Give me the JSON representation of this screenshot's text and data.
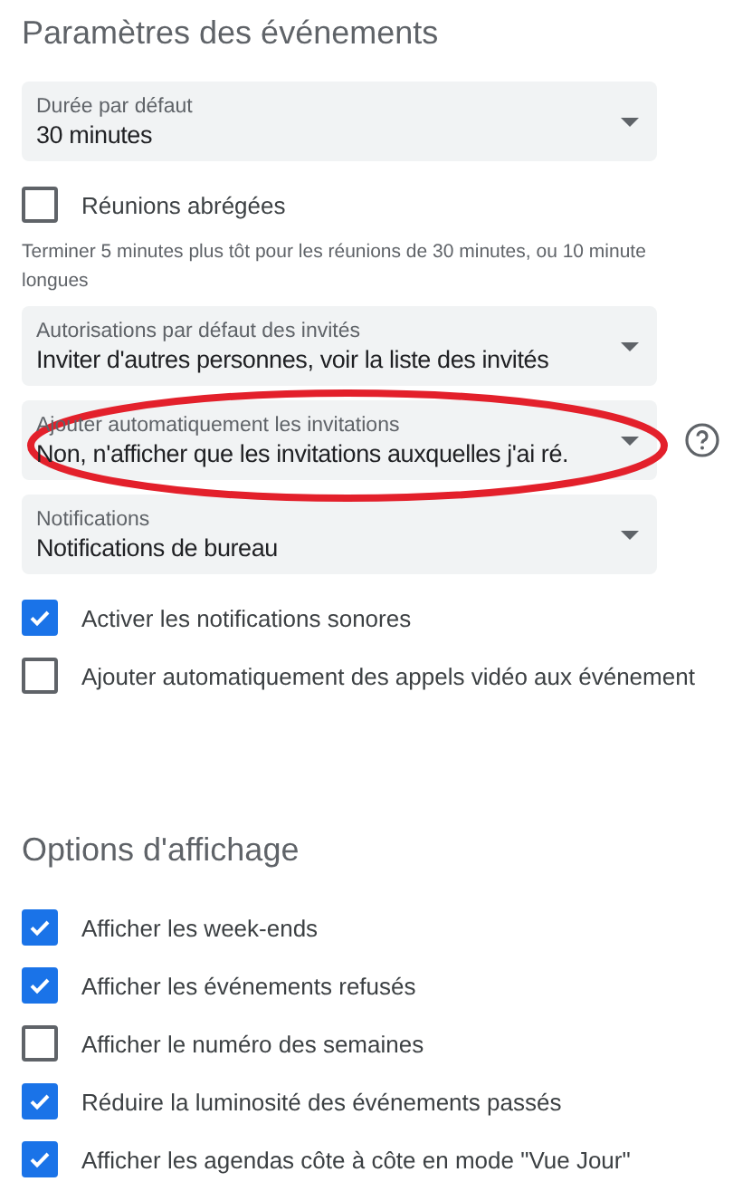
{
  "sections": [
    {
      "title": "Paramètres des événements",
      "items": [
        {
          "kind": "select",
          "label": "Durée par défaut",
          "value": "30 minutes"
        },
        {
          "kind": "checkbox",
          "label": "Réunions abrégées",
          "checked": false
        },
        {
          "kind": "help",
          "lines": [
            "Terminer 5 minutes plus tôt pour les réunions de 30 minutes, ou 10 minute",
            "longues"
          ]
        },
        {
          "kind": "select",
          "label": "Autorisations par défaut des invités",
          "value": "Inviter d'autres personnes, voir la liste des invités"
        },
        {
          "kind": "select",
          "label": "Ajouter automatiquement les invitations",
          "value": "Non, n'afficher que les invitations auxquelles j'ai ré.",
          "help_icon": true,
          "circled": true
        },
        {
          "kind": "select",
          "label": "Notifications",
          "value": "Notifications de bureau"
        },
        {
          "kind": "checkbox",
          "label": "Activer les notifications sonores",
          "checked": true
        },
        {
          "kind": "checkbox",
          "label": "Ajouter automatiquement des appels vidéo aux événement",
          "checked": false
        }
      ]
    },
    {
      "title": "Options d'affichage",
      "items": [
        {
          "kind": "checkbox",
          "label": "Afficher les week-ends",
          "checked": true
        },
        {
          "kind": "checkbox",
          "label": "Afficher les événements refusés",
          "checked": true
        },
        {
          "kind": "checkbox",
          "label": "Afficher le numéro des semaines",
          "checked": false
        },
        {
          "kind": "checkbox",
          "label": "Réduire la luminosité des événements passés",
          "checked": true
        },
        {
          "kind": "checkbox",
          "label": "Afficher les agendas côte à côte en mode \"Vue Jour\"",
          "checked": true
        }
      ]
    }
  ]
}
